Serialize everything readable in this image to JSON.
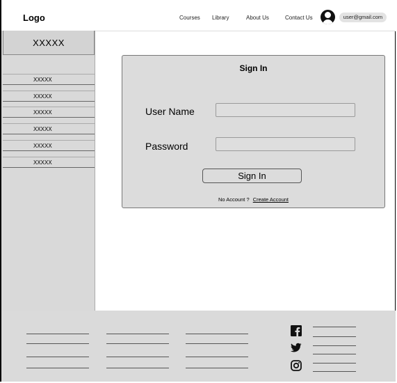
{
  "header": {
    "logo": "Logo",
    "nav": [
      "Courses",
      "Library",
      "About Us",
      "Contact Us"
    ],
    "user_email": "user@gmail.com"
  },
  "sidebar": {
    "title": "XXXXX",
    "items": [
      "XXXXX",
      "XXXXX",
      "XXXXX",
      "XXXXX",
      "XXXXX",
      "XXXXX"
    ]
  },
  "signin": {
    "title": "Sign In",
    "username_label": "User Name",
    "password_label": "Password",
    "username_value": "",
    "password_value": "",
    "button_label": "Sign In",
    "no_account_text": "No Account ?",
    "create_account_link": "Create Account"
  },
  "footer": {
    "social_icons": [
      "facebook-icon",
      "twitter-icon",
      "instagram-icon"
    ]
  }
}
